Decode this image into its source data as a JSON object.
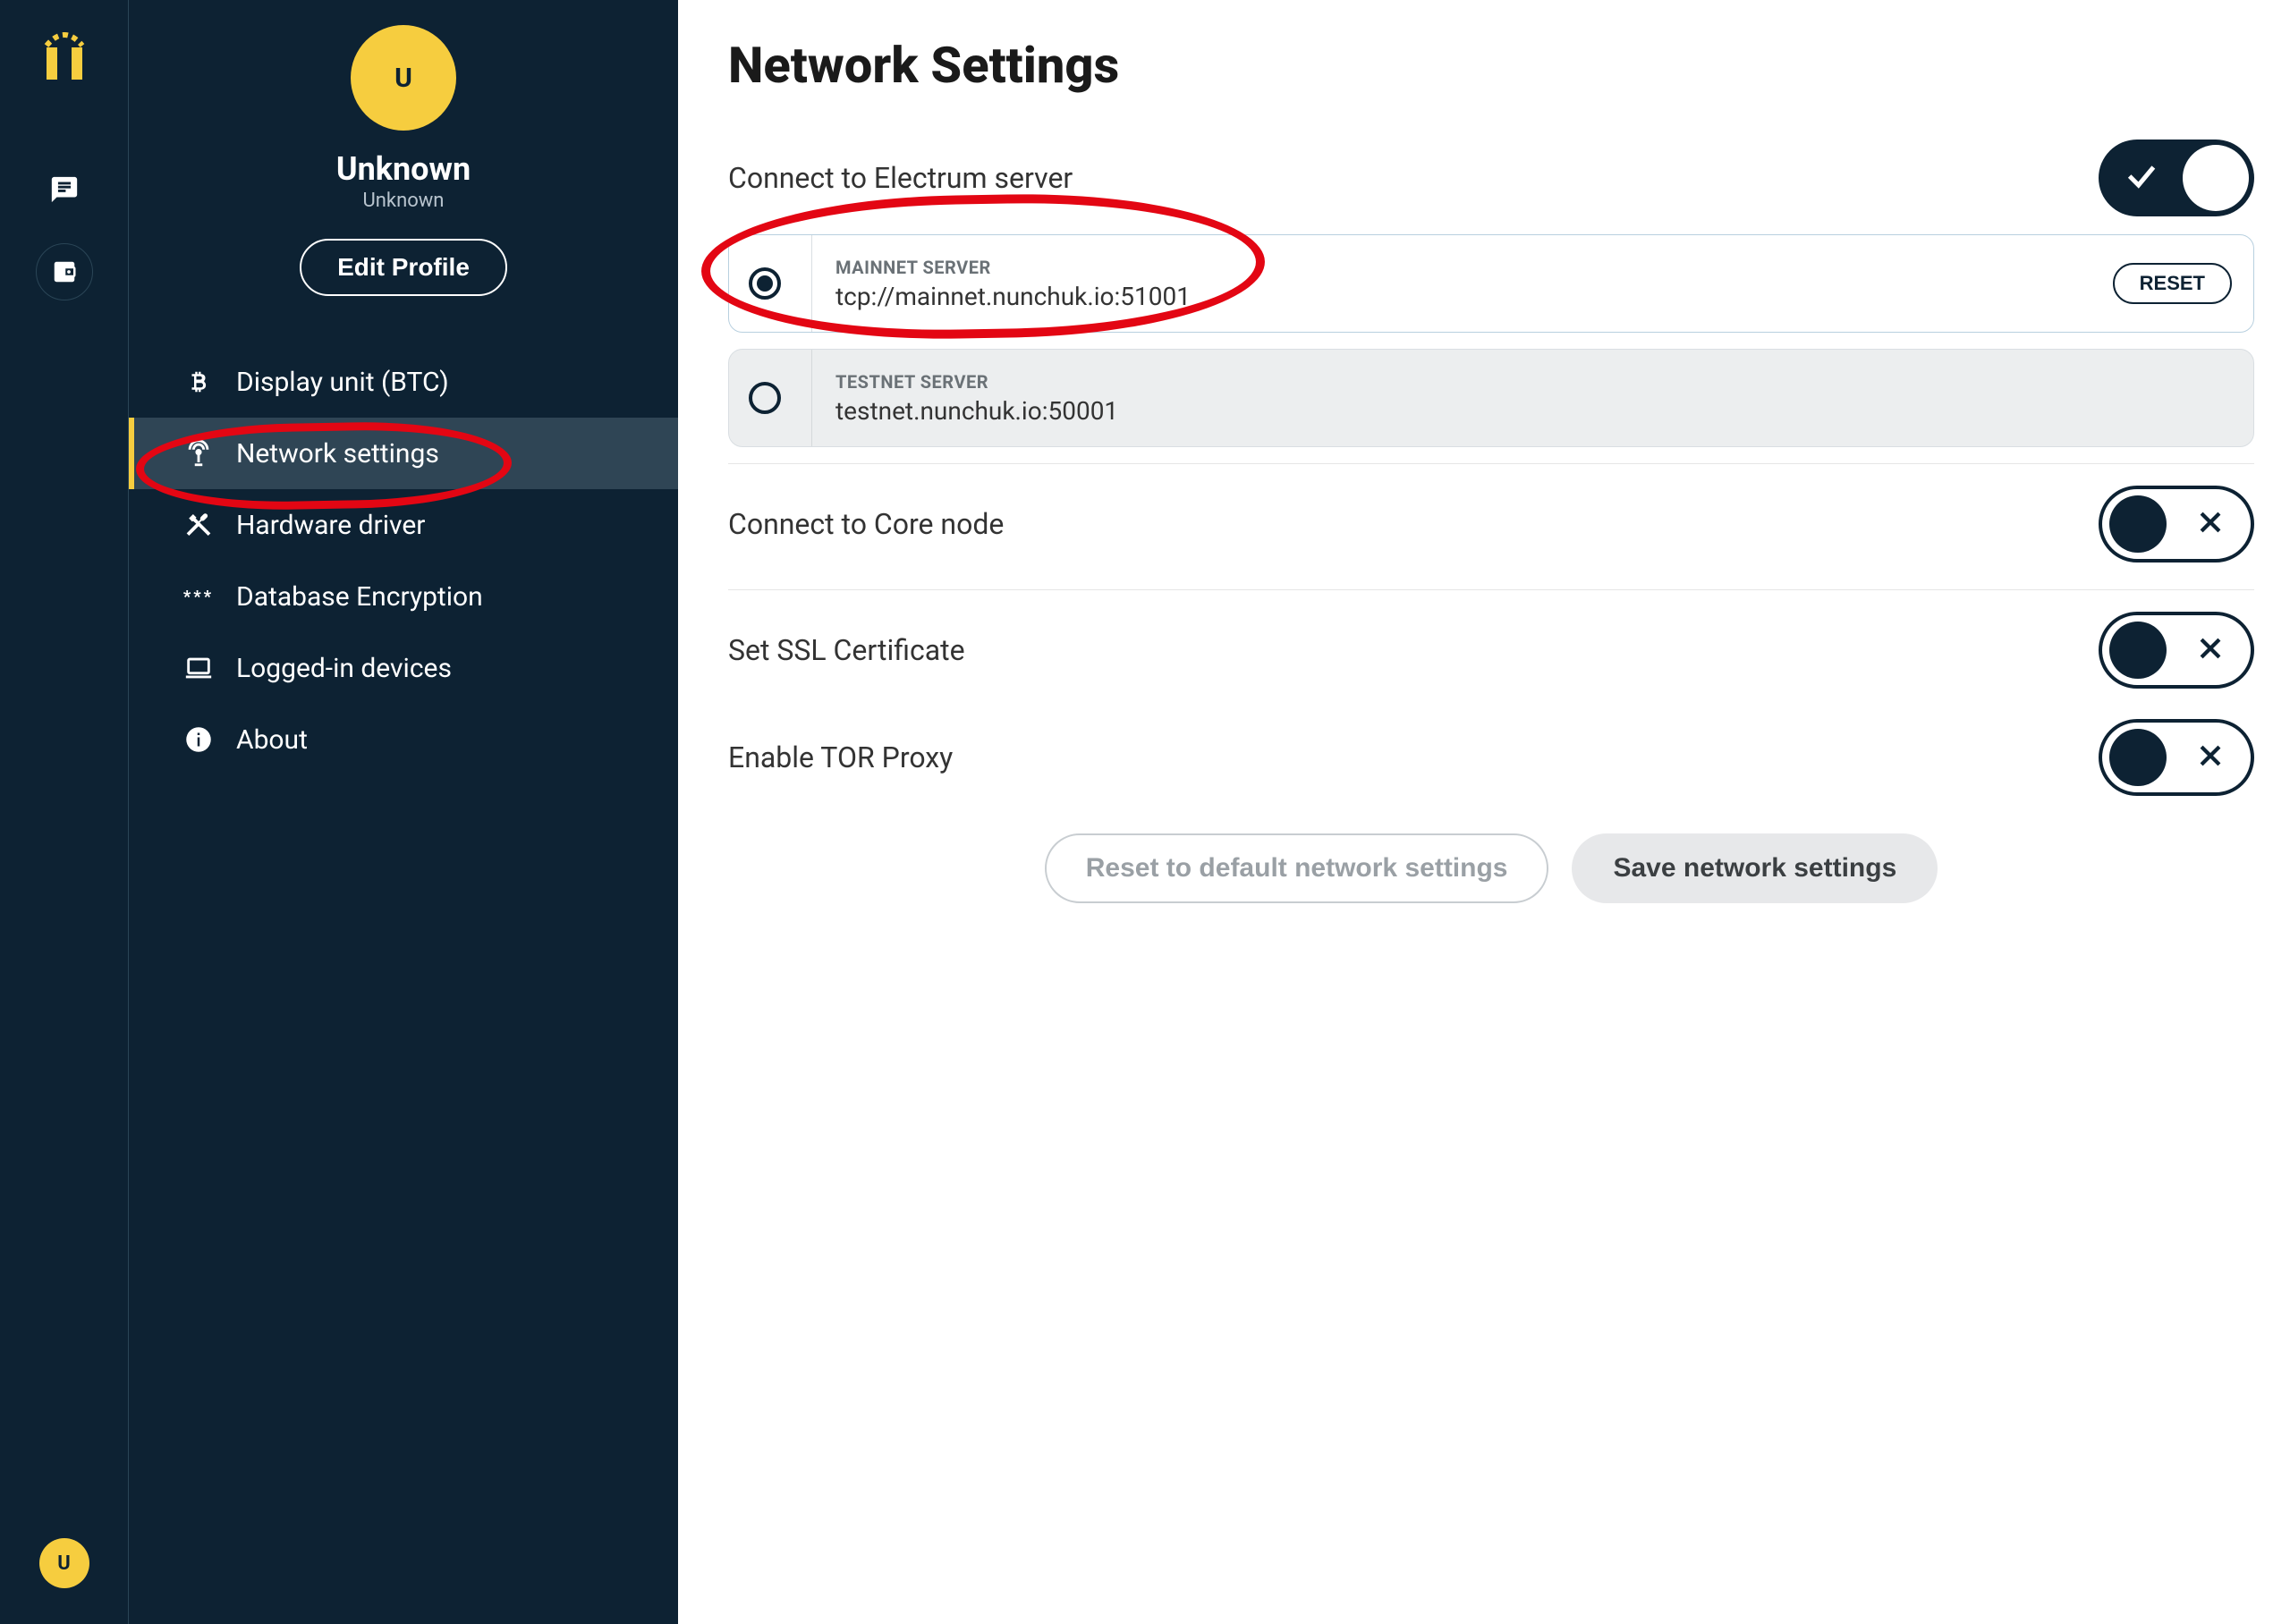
{
  "profile": {
    "avatarInitial": "U",
    "name": "Unknown",
    "sub": "Unknown",
    "editBtn": "Edit Profile"
  },
  "railAvatarInitial": "U",
  "sidebar": {
    "items": [
      {
        "label": "Display unit (BTC)",
        "icon": "bitcoin-icon"
      },
      {
        "label": "Network settings",
        "icon": "antenna-icon",
        "active": true
      },
      {
        "label": "Hardware driver",
        "icon": "tools-icon"
      },
      {
        "label": "Database Encryption",
        "icon": "password-icon"
      },
      {
        "label": "Logged-in devices",
        "icon": "laptop-icon"
      },
      {
        "label": "About",
        "icon": "info-icon"
      }
    ]
  },
  "page": {
    "title": "Network Settings",
    "electrum": {
      "label": "Connect to Electrum server",
      "enabled": true,
      "servers": [
        {
          "name": "MAINNET SERVER",
          "value": "tcp://mainnet.nunchuk.io:51001",
          "selected": true,
          "reset": "RESET"
        },
        {
          "name": "TESTNET SERVER",
          "value": "testnet.nunchuk.io:50001",
          "selected": false
        }
      ]
    },
    "coreNode": {
      "label": "Connect to Core node",
      "enabled": false
    },
    "ssl": {
      "label": "Set SSL Certificate",
      "enabled": false
    },
    "tor": {
      "label": "Enable TOR Proxy",
      "enabled": false
    },
    "buttons": {
      "reset": "Reset to default network settings",
      "save": "Save network settings"
    }
  },
  "annotations": [
    "circle-around-mainnet-server",
    "circle-around-network-settings-menu"
  ]
}
